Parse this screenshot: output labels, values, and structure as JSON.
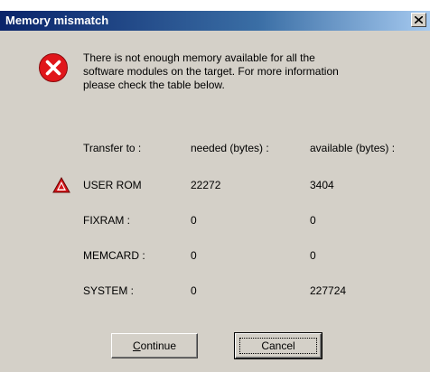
{
  "dialog": {
    "title": "Memory mismatch",
    "message_lines": [
      "There is not enough memory available for all the",
      "software modules on the target. For more information",
      "please check the table below."
    ]
  },
  "table": {
    "headers": [
      "Transfer to :",
      "needed (bytes) :",
      "available (bytes) :"
    ],
    "rows": [
      {
        "target": "USER ROM",
        "needed": "22272",
        "available": "3404",
        "warning": true
      },
      {
        "target": "FIXRAM :",
        "needed": "0",
        "available": "0",
        "warning": false
      },
      {
        "target": "MEMCARD :",
        "needed": "0",
        "available": "0",
        "warning": false
      },
      {
        "target": "SYSTEM :",
        "needed": "0",
        "available": "227724",
        "warning": false
      }
    ]
  },
  "buttons": {
    "continue_mnemonic": "C",
    "continue_rest": "ontinue",
    "cancel_label": "Cancel"
  },
  "icons": {
    "close": "close-icon",
    "error": "error-icon",
    "warning": "warning-icon"
  },
  "colors": {
    "dialog_bg": "#d4d0c8",
    "title_start": "#0a246a",
    "title_end": "#a6caf0",
    "error_red": "#e0161b",
    "warning_red": "#d4151a"
  }
}
